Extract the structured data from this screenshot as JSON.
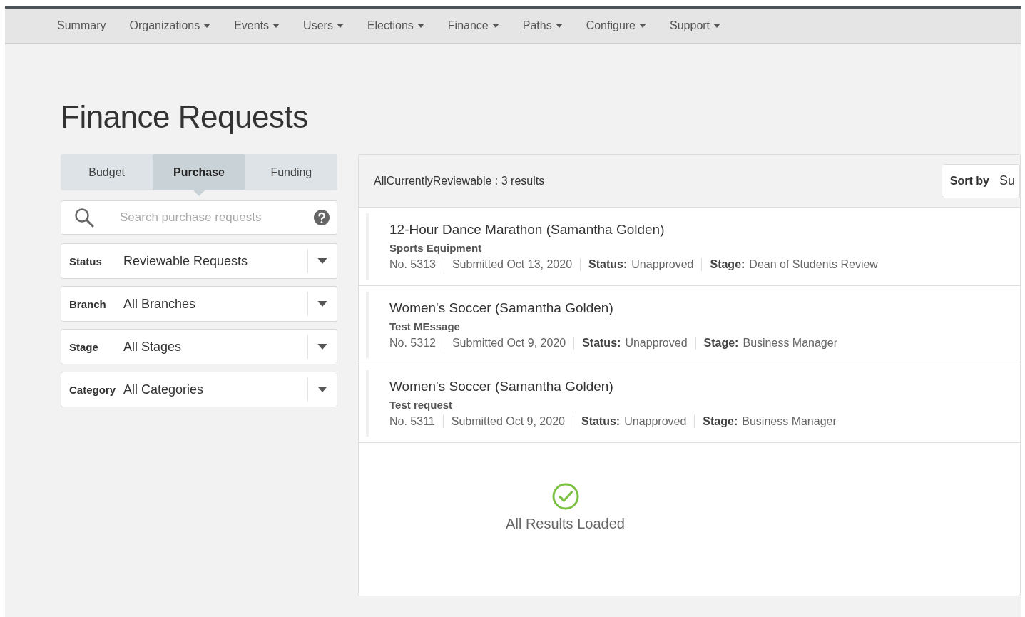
{
  "nav": [
    {
      "label": "Summary",
      "dropdown": false
    },
    {
      "label": "Organizations",
      "dropdown": true
    },
    {
      "label": "Events",
      "dropdown": true
    },
    {
      "label": "Users",
      "dropdown": true
    },
    {
      "label": "Elections",
      "dropdown": true
    },
    {
      "label": "Finance",
      "dropdown": true
    },
    {
      "label": "Paths",
      "dropdown": true
    },
    {
      "label": "Configure",
      "dropdown": true
    },
    {
      "label": "Support",
      "dropdown": true
    }
  ],
  "page_title": "Finance Requests",
  "tabs": [
    {
      "label": "Budget",
      "selected": false
    },
    {
      "label": "Purchase",
      "selected": true
    },
    {
      "label": "Funding",
      "selected": false
    }
  ],
  "search": {
    "placeholder": "Search purchase requests"
  },
  "filters": [
    {
      "label": "Status",
      "value": "Reviewable Requests"
    },
    {
      "label": "Branch",
      "value": "All Branches"
    },
    {
      "label": "Stage",
      "value": "All Stages"
    },
    {
      "label": "Category",
      "value": "All Categories"
    }
  ],
  "results": {
    "summary": "AllCurrentlyReviewable : 3 results",
    "sort_label": "Sort by",
    "sort_value": "Su",
    "items": [
      {
        "title": "12-Hour Dance Marathon (Samantha Golden)",
        "category": "Sports Equipment",
        "number": "No. 5313",
        "submitted": "Submitted Oct 13, 2020",
        "status_label": "Status:",
        "status": "Unapproved",
        "stage_label": "Stage:",
        "stage": "Dean of Students Review"
      },
      {
        "title": "Women's Soccer (Samantha Golden)",
        "category": "Test MEssage",
        "number": "No. 5312",
        "submitted": "Submitted Oct 9, 2020",
        "status_label": "Status:",
        "status": "Unapproved",
        "stage_label": "Stage:",
        "stage": "Business Manager"
      },
      {
        "title": "Women's Soccer (Samantha Golden)",
        "category": "Test request",
        "number": "No. 5311",
        "submitted": "Submitted Oct 9, 2020",
        "status_label": "Status:",
        "status": "Unapproved",
        "stage_label": "Stage:",
        "stage": "Business Manager"
      }
    ],
    "footer": "All Results Loaded"
  }
}
